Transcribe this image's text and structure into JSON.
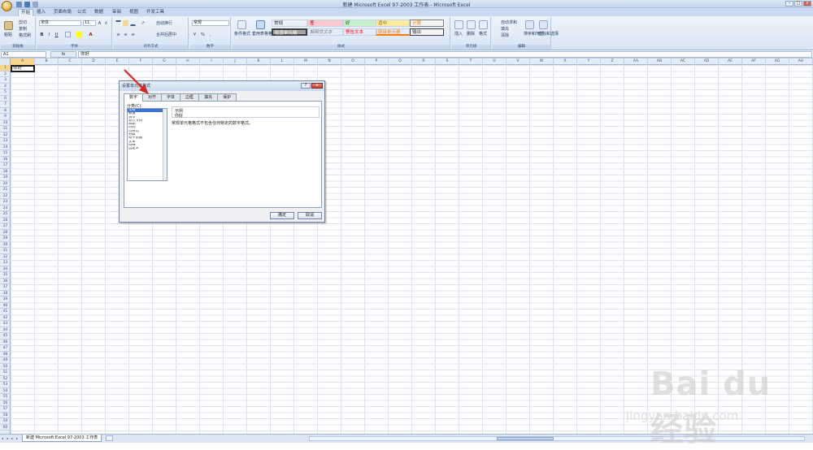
{
  "window": {
    "title": "新建 Microsoft Excel 97-2003 工作表 - Microsoft Excel"
  },
  "ribbon_tabs": [
    {
      "label": "开始",
      "active": true
    },
    {
      "label": "插入"
    },
    {
      "label": "页面布局"
    },
    {
      "label": "公式"
    },
    {
      "label": "数据"
    },
    {
      "label": "审阅"
    },
    {
      "label": "视图"
    },
    {
      "label": "开发工具"
    }
  ],
  "clipboard": {
    "paste": "粘贴",
    "cut": "剪切",
    "copy": "复制",
    "format_painter": "格式刷",
    "group": "剪贴板"
  },
  "font": {
    "name": "宋体",
    "size": "11",
    "group": "字体",
    "bold": "B",
    "italic": "I",
    "underline": "U",
    "grow": "A",
    "shrink": "A"
  },
  "alignment": {
    "wrap": "自动换行",
    "merge": "合并后居中",
    "group": "对齐方式"
  },
  "number": {
    "format": "常规",
    "percent": "%",
    "comma": ",",
    "group": "数字"
  },
  "styles": {
    "conditional": "条件格式",
    "table": "套用表格格式",
    "group": "样式",
    "cells": [
      {
        "label": "常规",
        "bg": "#ffffff",
        "color": "#000000"
      },
      {
        "label": "差",
        "bg": "#ffc7ce",
        "color": "#9c0006"
      },
      {
        "label": "好",
        "bg": "#c6efce",
        "color": "#006100"
      },
      {
        "label": "适中",
        "bg": "#ffeb9c",
        "color": "#9c6500"
      },
      {
        "label": "计算",
        "bg": "#f2f2f2",
        "color": "#fa7d00"
      },
      {
        "label": "检查单元格",
        "bg": "#a5a5a5",
        "color": "#ffffff"
      },
      {
        "label": "解释性文本",
        "bg": "#ffffff",
        "color": "#7f7f7f"
      },
      {
        "label": "警告文本",
        "bg": "#ffffff",
        "color": "#ff0000"
      },
      {
        "label": "链接单元格",
        "bg": "#ffffff",
        "color": "#fa7d00"
      },
      {
        "label": "输出",
        "bg": "#f2f2f2",
        "color": "#3f3f3f"
      }
    ]
  },
  "cells_group": {
    "insert": "插入",
    "delete": "删除",
    "format": "格式",
    "group": "单元格"
  },
  "editing": {
    "autosum": "自动求和",
    "fill": "填充",
    "clear": "清除",
    "sort": "排序和筛选",
    "find": "查找和选择",
    "group": "编辑"
  },
  "formula_bar": {
    "name_box": "A1",
    "fx": "fx",
    "value": "你好"
  },
  "columns": [
    "A",
    "B",
    "C",
    "D",
    "E",
    "F",
    "G",
    "H",
    "I",
    "J",
    "K",
    "L",
    "M",
    "N",
    "O",
    "P",
    "Q",
    "R",
    "S",
    "T",
    "U",
    "V",
    "W",
    "X",
    "Y",
    "Z",
    "AA",
    "AB",
    "AC",
    "AD",
    "AE",
    "AF",
    "AG",
    "AH"
  ],
  "rows": [
    "1",
    "2",
    "3",
    "4",
    "5",
    "6",
    "7",
    "8",
    "9",
    "10",
    "11",
    "12",
    "13",
    "14",
    "15",
    "16",
    "17",
    "18",
    "19",
    "20",
    "21",
    "22",
    "23",
    "24",
    "25",
    "26",
    "27",
    "28",
    "29",
    "30",
    "31",
    "32",
    "33",
    "34",
    "35",
    "36",
    "37",
    "38",
    "39",
    "40",
    "41",
    "42",
    "43",
    "44",
    "45",
    "46",
    "47",
    "48",
    "49",
    "50",
    "51",
    "52",
    "53",
    "54",
    "55",
    "56",
    "57",
    "58",
    "59",
    "60"
  ],
  "cell_a1": "你好",
  "dialog": {
    "title": "设置单元格格式",
    "help": "?",
    "close": "x",
    "tabs": [
      "数字",
      "对齐",
      "字体",
      "边框",
      "填充",
      "保护"
    ],
    "category_label": "分类(C):",
    "categories": [
      "常规",
      "数值",
      "货币",
      "会计专用",
      "日期",
      "时间",
      "百分比",
      "分数",
      "科学记数",
      "文本",
      "特殊",
      "自定义"
    ],
    "selected_category": "常规",
    "sample_label": "示例",
    "sample_value": "你好",
    "description": "常规单元格格式不包含任何特定的数字格式。",
    "ok": "确定",
    "cancel": "取消"
  },
  "sheet": {
    "tab": "新建 Microsoft Excel 97-2003 工作表"
  },
  "watermark": {
    "brand": "Bai du经验",
    "url": "jingyan.baidu.com"
  }
}
